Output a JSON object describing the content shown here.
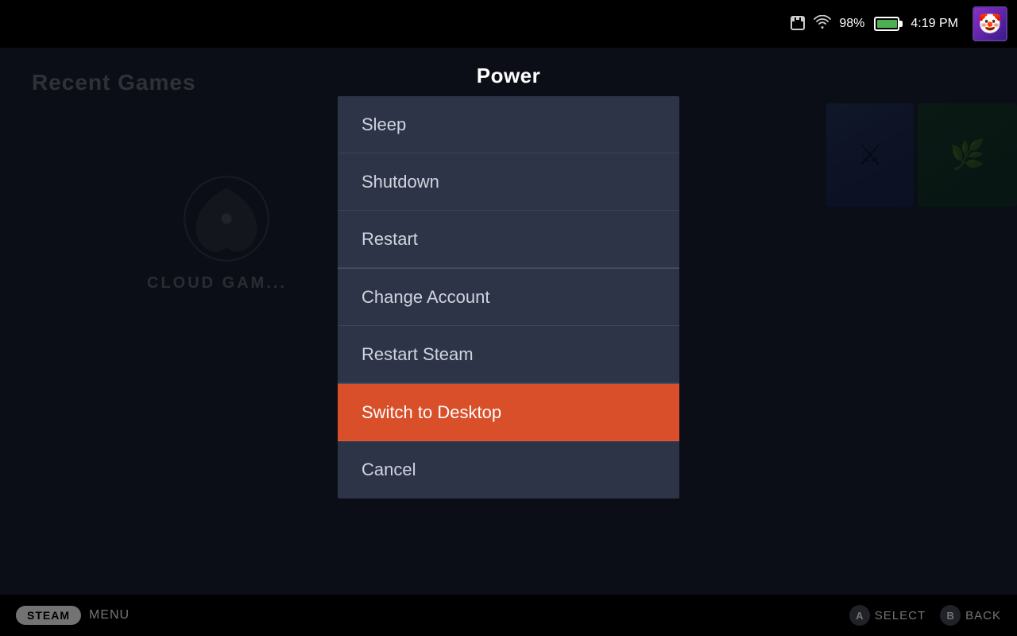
{
  "topbar": {
    "battery_pct": "98%",
    "time": "4:19 PM",
    "avatar_emoji": "🤡"
  },
  "background": {
    "recent_games_label": "Recent Games"
  },
  "power_dialog": {
    "title": "Power",
    "menu_items": [
      {
        "id": "sleep",
        "label": "Sleep",
        "active": false
      },
      {
        "id": "shutdown",
        "label": "Shutdown",
        "active": false
      },
      {
        "id": "restart",
        "label": "Restart",
        "active": false
      },
      {
        "id": "change-account",
        "label": "Change Account",
        "active": false
      },
      {
        "id": "restart-steam",
        "label": "Restart Steam",
        "active": false
      },
      {
        "id": "switch-to-desktop",
        "label": "Switch to Desktop",
        "active": true
      },
      {
        "id": "cancel",
        "label": "Cancel",
        "active": false
      }
    ]
  },
  "bottombar": {
    "steam_label": "STEAM",
    "menu_label": "MENU",
    "select_label": "SELECT",
    "back_label": "BACK",
    "a_button": "A",
    "b_button": "B"
  }
}
